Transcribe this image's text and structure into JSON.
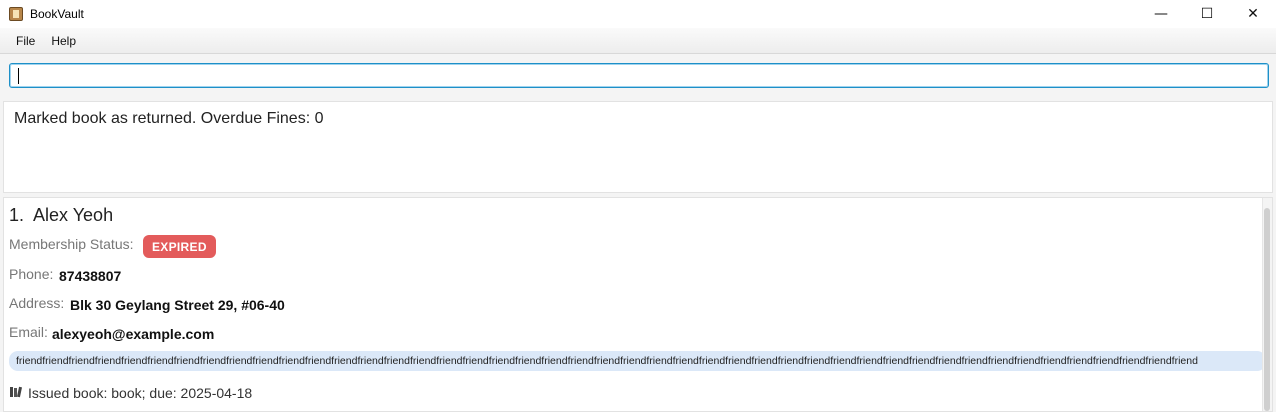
{
  "window": {
    "title": "BookVault",
    "controls": {
      "minimize": "—",
      "maximize": "☐",
      "close": "✕"
    }
  },
  "menu": {
    "items": [
      "File",
      "Help"
    ]
  },
  "command": {
    "value": "",
    "placeholder": ""
  },
  "result": {
    "message": "Marked book as returned. Overdue Fines: 0"
  },
  "people": [
    {
      "index": "1.",
      "name": "Alex Yeoh",
      "membership_label": "Membership Status:",
      "membership_status": "EXPIRED",
      "status_color": "#e35b5b",
      "phone_label": "Phone:",
      "phone": "87438807",
      "address_label": "Address:",
      "address": "Blk 30 Geylang Street 29, #06-40",
      "email_label": "Email:",
      "email": "alexyeoh@example.com",
      "tag": "friendfriendfriendfriendfriendfriendfriendfriendfriendfriendfriendfriendfriendfriendfriendfriendfriendfriendfriendfriendfriendfriendfriendfriendfriendfriendfriendfriendfriendfriendfriendfriendfriendfriendfriendfriendfriendfriendfriendfriendfriendfriendfriendfriendfriend",
      "issued_icon": "books-icon",
      "issued": "Issued book: book; due: 2025-04-18"
    }
  ],
  "colors": {
    "accent": "#1e90c8",
    "tag_bg": "#dbe8f8",
    "expired": "#e35b5b"
  }
}
